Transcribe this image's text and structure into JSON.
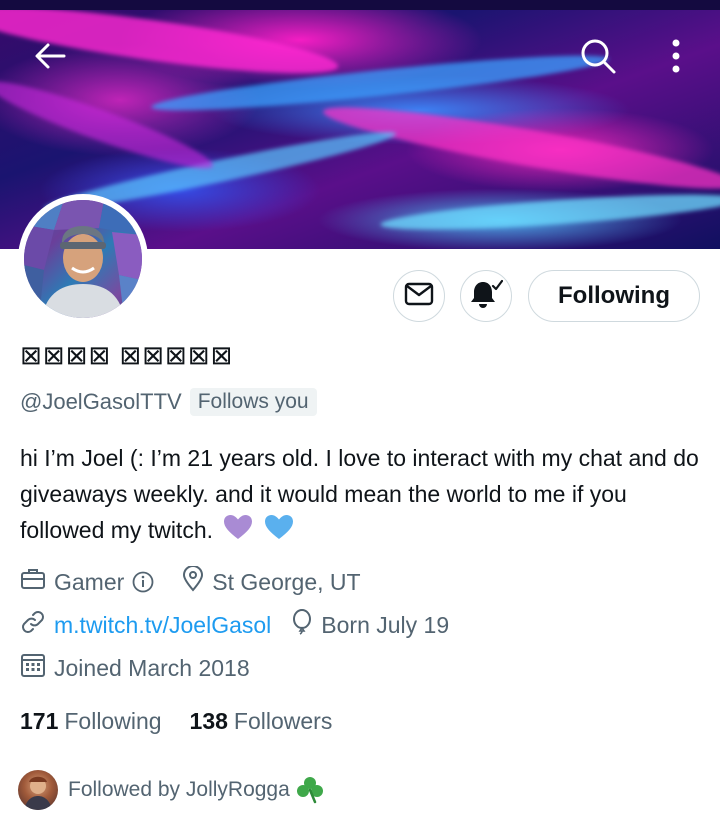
{
  "header": {
    "back_icon": "arrow-left-icon",
    "search_icon": "search-icon",
    "more_icon": "more-vertical-icon"
  },
  "profile": {
    "display_name": "⊠⊠⊠⊠ ⊠⊠⊠⊠⊠",
    "handle": "@JoelGasolTTV",
    "follows_you": "Follows you",
    "bio": "hi I’m Joel (: I’m 21 years old. I love to interact with my chat and do giveaways weekly. and it would mean the world to me if you followed my twitch.",
    "bio_emoji": [
      "purple-heart",
      "blue-heart"
    ]
  },
  "actions": {
    "message_icon": "envelope-icon",
    "notify_icon": "bell-check-icon",
    "following_label": "Following"
  },
  "meta": {
    "category": "Gamer",
    "location": "St George, UT",
    "link": "m.twitch.tv/JoelGasol",
    "birthday": "Born July 19",
    "joined": "Joined March 2018"
  },
  "counts": {
    "following_count": "171",
    "following_label": "Following",
    "followers_count": "138",
    "followers_label": "Followers"
  },
  "followed_by": {
    "text": "Followed by JollyRogga",
    "emoji": "shamrock"
  },
  "colors": {
    "link_blue": "#1d9bf0",
    "secondary_text": "#536471",
    "primary_text": "#0f1419",
    "border": "#cfd9de"
  }
}
